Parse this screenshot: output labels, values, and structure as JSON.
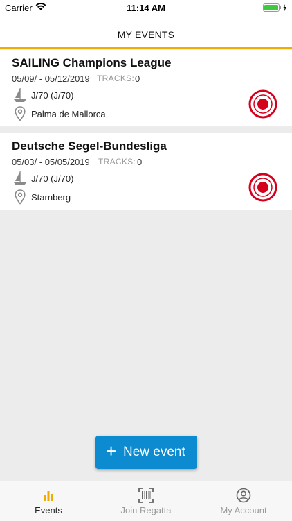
{
  "status_bar": {
    "carrier": "Carrier",
    "time": "11:14 AM"
  },
  "nav": {
    "title": "MY EVENTS"
  },
  "accent_color": "#f0ac00",
  "events": [
    {
      "title": "SAILING Champions League",
      "dates": "05/09/ - 05/12/2019",
      "tracks_label": "TRACKS:",
      "tracks_value": "0",
      "boat": "J/70  (J/70)",
      "location": "Palma de Mallorca",
      "icons": [
        "sailboat-icon",
        "location-pin-icon",
        "record-icon"
      ]
    },
    {
      "title": "Deutsche Segel-Bundesliga",
      "dates": "05/03/ - 05/05/2019",
      "tracks_label": "TRACKS:",
      "tracks_value": "0",
      "boat": "J/70  (J/70)",
      "location": "Starnberg",
      "icons": [
        "sailboat-icon",
        "location-pin-icon",
        "record-icon"
      ]
    }
  ],
  "new_event": {
    "plus": "+",
    "label": "New event",
    "color": "#0d8bd0"
  },
  "record_color": "#d5001c",
  "tabs": [
    {
      "label": "Events",
      "icon": "bar-chart-icon",
      "active": true
    },
    {
      "label": "Join Regatta",
      "icon": "qr-scan-icon",
      "active": false
    },
    {
      "label": "My Account",
      "icon": "user-circle-icon",
      "active": false
    }
  ]
}
